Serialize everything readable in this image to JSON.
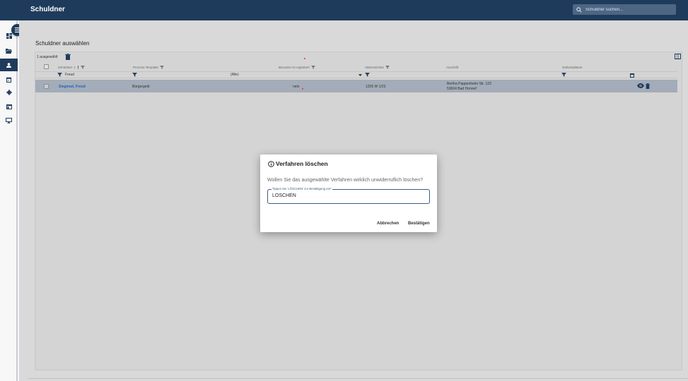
{
  "app": {
    "title": "Schuldner"
  },
  "search": {
    "placeholder": "Schuldner suchen..."
  },
  "page": {
    "title": "Schuldner auswählen",
    "selected_count": "1 ausgewählt"
  },
  "table": {
    "headers": [
      "Schuldner",
      "Prozess-Template",
      "Benutzer ist registriert",
      "Aktenzeichen",
      "Anschrift",
      "Geburtsdatum"
    ],
    "sort_indicator": "1",
    "filters": {
      "schuldner": "Freud",
      "registriert": "(Alle)"
    },
    "rows": [
      {
        "schuldner": "Siegmud, Freud",
        "template": "Bürgergeld",
        "registriert": "nein",
        "aktenzeichen": "1205 W 1/23",
        "anschrift_line1": "Bertha Pappenheim Str. 123",
        "anschrift_line2": "53604 Bad Honnef",
        "geburtsdatum": ""
      }
    ]
  },
  "dialog": {
    "title": "Verfahren löschen",
    "message": "Wollen Sie das ausgewählte Verfahren wirklich unwiderruflich löschen?",
    "field_label": "Tippen Sie 'LÖSCHEN' zur Bestätigung ein*",
    "field_value": "LÖSCHEN",
    "cancel_label": "Abbrechen",
    "confirm_label": "Bestätigen"
  },
  "colors": {
    "primary": "#1f3b5c",
    "selected_row": "#a3acb8",
    "link": "#1e63b8"
  }
}
